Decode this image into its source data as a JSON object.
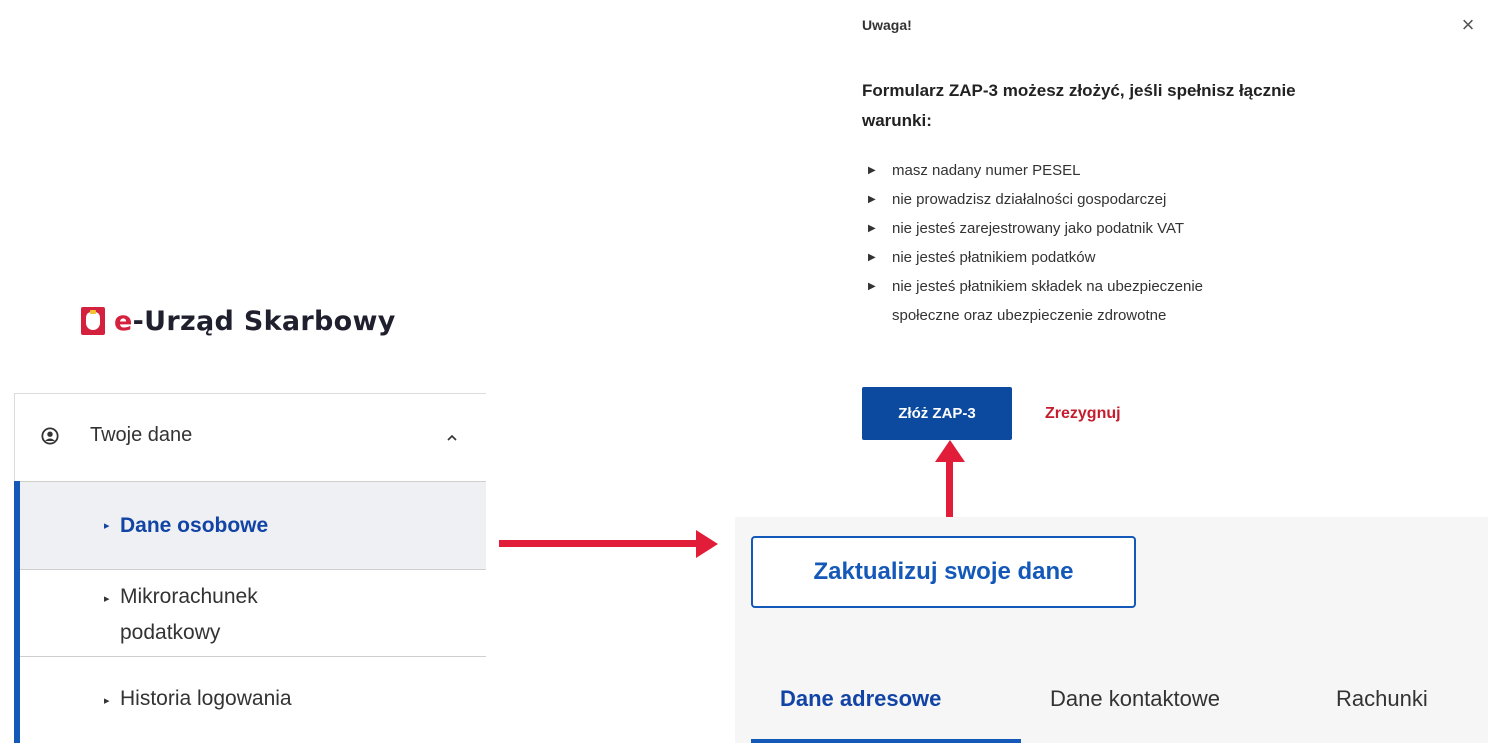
{
  "brand": {
    "prefix": "e",
    "name": "-Urząd Skarbowy"
  },
  "sidebar": {
    "section_label": "Twoje dane",
    "items": [
      {
        "label": "Dane osobowe",
        "active": true
      },
      {
        "label": "Mikrorachunek",
        "label2": "podatkowy",
        "active": false
      },
      {
        "label": "Historia logowania",
        "active": false
      }
    ]
  },
  "dialog": {
    "title": "Uwaga!",
    "close_icon": "close-icon",
    "heading_line1": "Formularz ZAP-3 możesz złożyć, jeśli spełnisz łącznie",
    "heading_line2": "warunki:",
    "conditions": [
      "masz nadany numer PESEL",
      "nie prowadzisz działalności gospodarczej",
      "nie jesteś zarejestrowany jako podatnik VAT",
      "nie jesteś płatnikiem podatków",
      "nie jesteś płatnikiem składek na ubezpieczenie",
      "społeczne oraz ubezpieczenie zdrowotne"
    ],
    "submit_label": "Złóż ZAP-3",
    "cancel_label": "Zrezygnuj"
  },
  "page": {
    "update_button": "Zaktualizuj swoje dane",
    "tabs": [
      {
        "label": "Dane adresowe",
        "active": true
      },
      {
        "label": "Dane kontaktowe",
        "active": false
      },
      {
        "label": "Rachunki",
        "active": false
      }
    ]
  },
  "colors": {
    "accent": "#1458b8",
    "brand_red": "#d4213d",
    "annotation_arrow": "#e21d3a",
    "cancel": "#c41d2e"
  }
}
